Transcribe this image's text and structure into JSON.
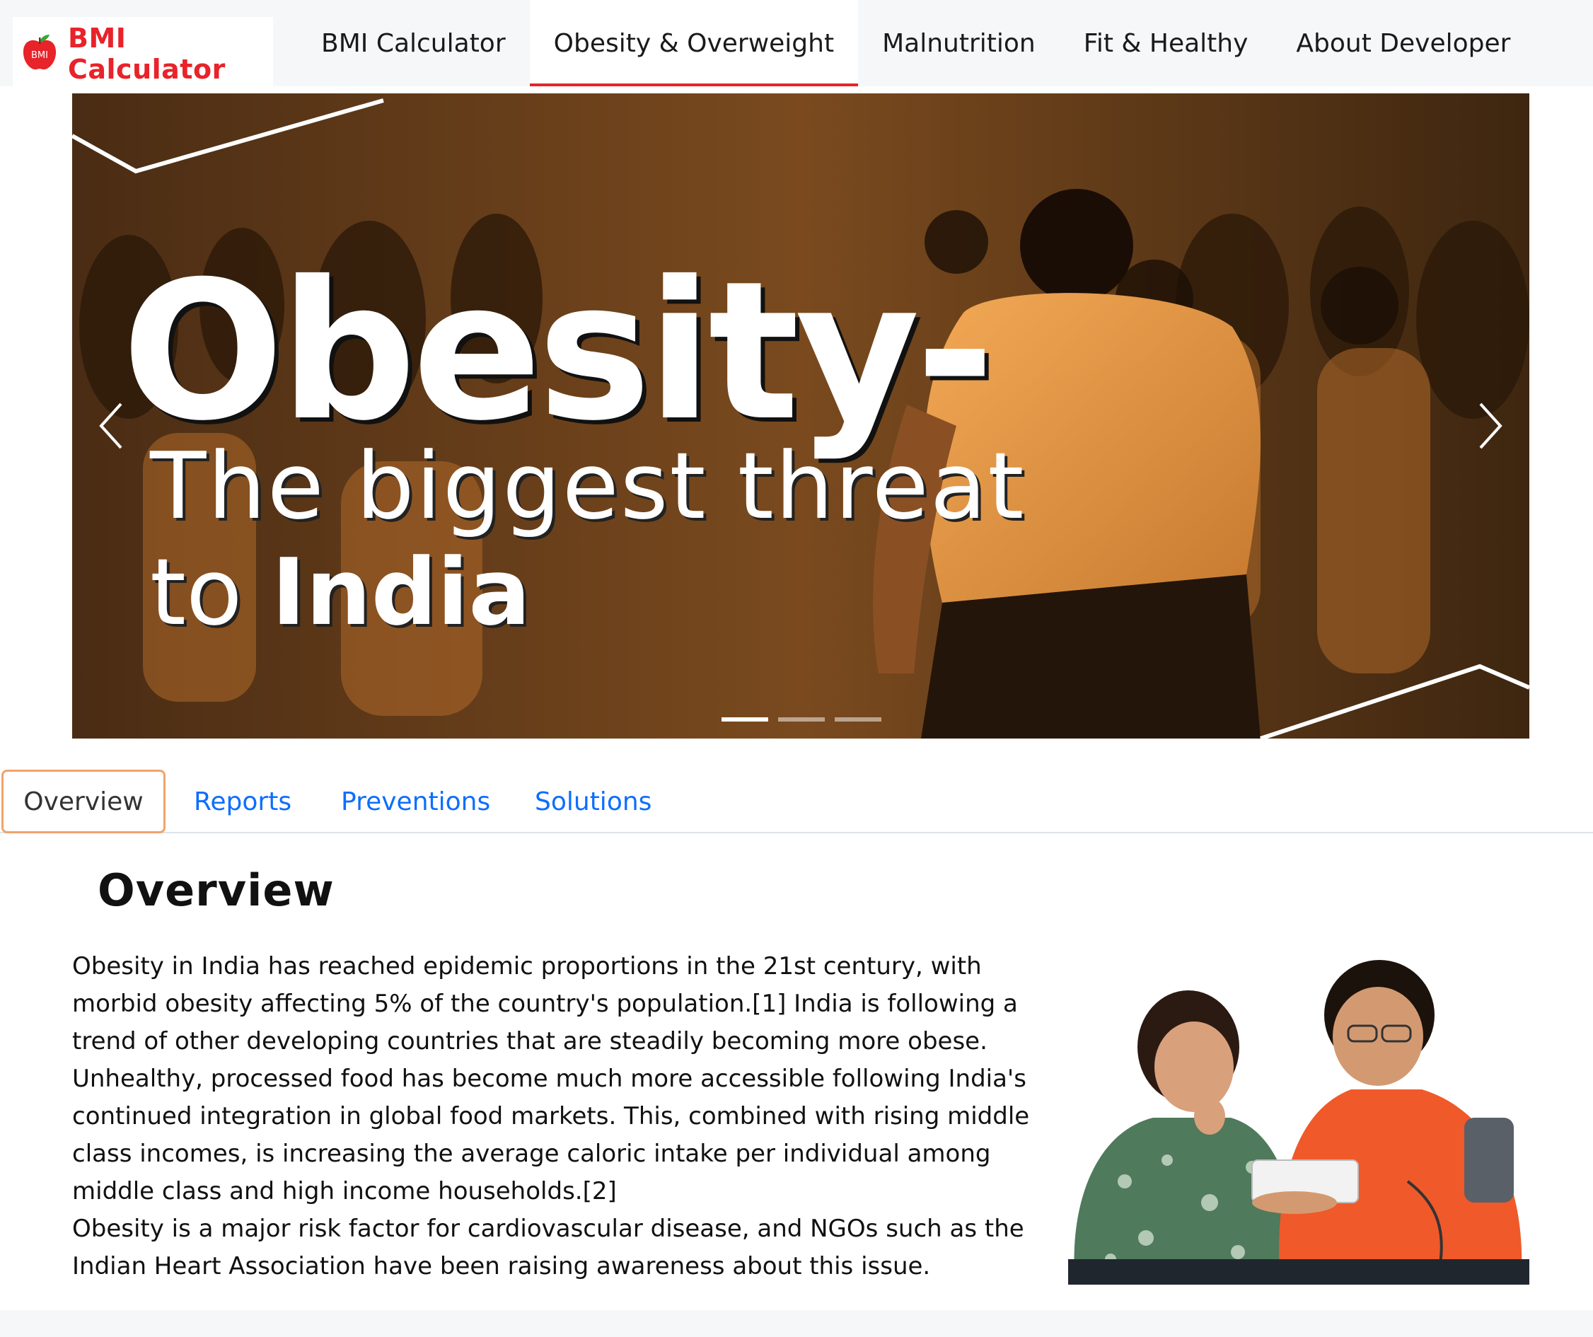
{
  "brand": {
    "icon_label": "BMI",
    "name": "BMI Calculator",
    "color": "#e8232a"
  },
  "nav": {
    "items": [
      {
        "label": "BMI Calculator",
        "active": false
      },
      {
        "label": "Obesity & Overweight",
        "active": true
      },
      {
        "label": "Malnutrition",
        "active": false
      },
      {
        "label": "Fit & Healthy",
        "active": false
      },
      {
        "label": "About Developer",
        "active": false
      }
    ]
  },
  "carousel": {
    "slide": {
      "title": "Obesity-",
      "subtitle_line1": "The biggest threat",
      "subtitle_line2_prefix": "to",
      "subtitle_line2_bold": "India"
    },
    "prev_icon": "chevron-left-icon",
    "next_icon": "chevron-right-icon",
    "indicator_count": 3,
    "active_index": 0
  },
  "tabs": {
    "items": [
      {
        "label": "Overview",
        "active": true
      },
      {
        "label": "Reports",
        "active": false
      },
      {
        "label": "Preventions",
        "active": false
      },
      {
        "label": "Solutions",
        "active": false
      }
    ],
    "link_color": "#0d6efd",
    "active_border_color": "#f0a46c"
  },
  "content": {
    "heading": "Overview",
    "paragraph1": "Obesity in India has reached epidemic proportions in the 21st century, with morbid obesity affecting 5% of the country's population.[1] India is following a trend of other developing countries that are steadily becoming more obese. Unhealthy, processed food has become much more accessible following India's continued integration in global food markets. This, combined with rising middle class incomes, is increasing the average caloric intake per individual among middle class and high income households.[2]",
    "paragraph2": "Obesity is a major risk factor for cardiovascular disease, and NGOs such as the Indian Heart Association have been raising awareness about this issue."
  }
}
